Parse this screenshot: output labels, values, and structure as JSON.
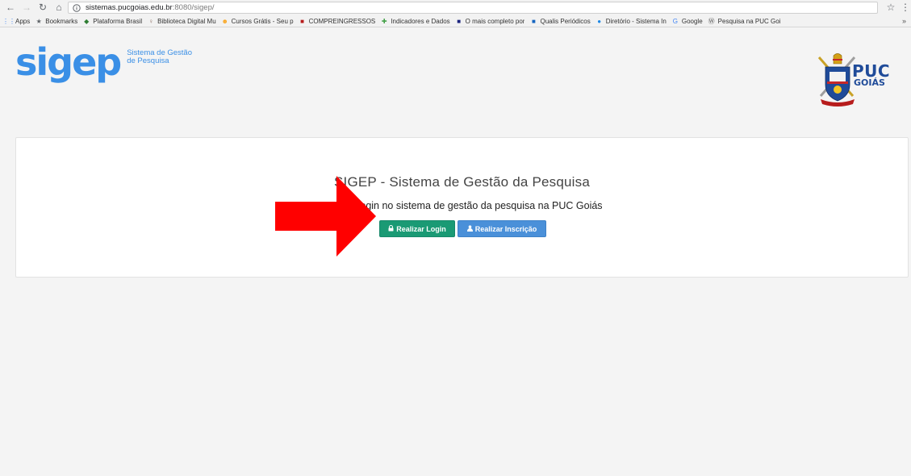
{
  "browser": {
    "url_host": "sistemas.pucgoias.edu.br",
    "url_rest": ":8080/sigep/",
    "bookmarks": [
      {
        "label": "Apps",
        "icon": "apps-grid-icon",
        "color": "#4285f4"
      },
      {
        "label": "Bookmarks",
        "icon": "star-icon",
        "color": "#5f6368"
      },
      {
        "label": "Plataforma Brasil",
        "icon": "plataforma-icon",
        "color": "#2e7d32"
      },
      {
        "label": "Biblioteca Digital Mu",
        "icon": "pin-icon",
        "color": "#8d6e63"
      },
      {
        "label": "Cursos Grátis - Seu p",
        "icon": "smiley-icon",
        "color": "#f9a825"
      },
      {
        "label": "COMPREINGRESSOS",
        "icon": "compreingressos-icon",
        "color": "#b71c1c"
      },
      {
        "label": "Indicadores e Dados",
        "icon": "indicadores-icon",
        "color": "#43a047"
      },
      {
        "label": "O mais completo por",
        "icon": "dm-icon",
        "color": "#1a237e"
      },
      {
        "label": "Qualis Periódicos",
        "icon": "qualis-icon",
        "color": "#1565c0"
      },
      {
        "label": "Diretório - Sistema In",
        "icon": "diretorio-icon",
        "color": "#1e88e5"
      },
      {
        "label": "Google",
        "icon": "google-icon",
        "color": "#4285f4"
      },
      {
        "label": "Pesquisa na PUC Goi",
        "icon": "wordpress-icon",
        "color": "#555555"
      }
    ],
    "more": "»"
  },
  "logo": {
    "word": "sigep",
    "sub_line1": "Sistema de Gestão",
    "sub_line2": "de Pesquisa"
  },
  "puc": {
    "line1": "PUC",
    "line2": "GOIÁS"
  },
  "main": {
    "title": "SIGEP - Sistema de Gestão da Pesquisa",
    "subtitle": "Realize login no sistema de gestão da pesquisa na PUC Goiás",
    "login_label": "Realizar Login",
    "signup_label": "Realizar Inscrição"
  },
  "colors": {
    "brand_blue": "#3a8fe6",
    "login_green": "#1a9a74",
    "signup_blue": "#4a90d9",
    "arrow_red": "#ff0000"
  }
}
